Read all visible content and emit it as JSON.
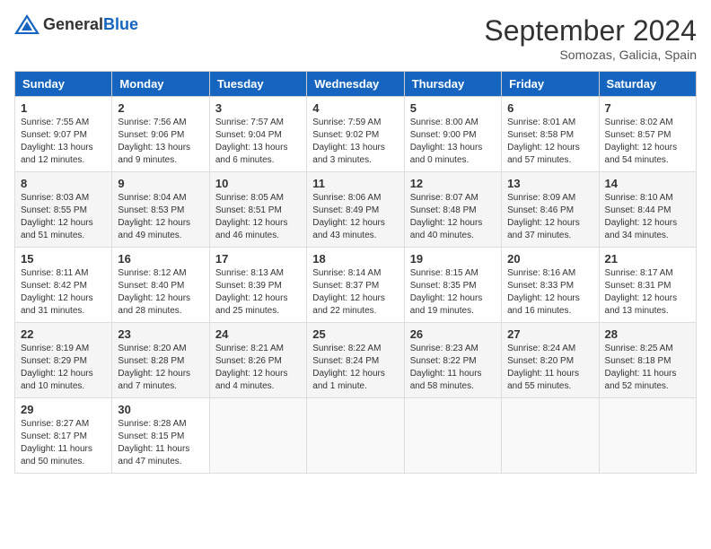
{
  "header": {
    "logo_general": "General",
    "logo_blue": "Blue",
    "month": "September 2024",
    "location": "Somozas, Galicia, Spain"
  },
  "weekdays": [
    "Sunday",
    "Monday",
    "Tuesday",
    "Wednesday",
    "Thursday",
    "Friday",
    "Saturday"
  ],
  "weeks": [
    [
      {
        "day": "1",
        "sunrise": "7:55 AM",
        "sunset": "9:07 PM",
        "daylight": "13 hours and 12 minutes."
      },
      {
        "day": "2",
        "sunrise": "7:56 AM",
        "sunset": "9:06 PM",
        "daylight": "13 hours and 9 minutes."
      },
      {
        "day": "3",
        "sunrise": "7:57 AM",
        "sunset": "9:04 PM",
        "daylight": "13 hours and 6 minutes."
      },
      {
        "day": "4",
        "sunrise": "7:59 AM",
        "sunset": "9:02 PM",
        "daylight": "13 hours and 3 minutes."
      },
      {
        "day": "5",
        "sunrise": "8:00 AM",
        "sunset": "9:00 PM",
        "daylight": "13 hours and 0 minutes."
      },
      {
        "day": "6",
        "sunrise": "8:01 AM",
        "sunset": "8:58 PM",
        "daylight": "12 hours and 57 minutes."
      },
      {
        "day": "7",
        "sunrise": "8:02 AM",
        "sunset": "8:57 PM",
        "daylight": "12 hours and 54 minutes."
      }
    ],
    [
      {
        "day": "8",
        "sunrise": "8:03 AM",
        "sunset": "8:55 PM",
        "daylight": "12 hours and 51 minutes."
      },
      {
        "day": "9",
        "sunrise": "8:04 AM",
        "sunset": "8:53 PM",
        "daylight": "12 hours and 49 minutes."
      },
      {
        "day": "10",
        "sunrise": "8:05 AM",
        "sunset": "8:51 PM",
        "daylight": "12 hours and 46 minutes."
      },
      {
        "day": "11",
        "sunrise": "8:06 AM",
        "sunset": "8:49 PM",
        "daylight": "12 hours and 43 minutes."
      },
      {
        "day": "12",
        "sunrise": "8:07 AM",
        "sunset": "8:48 PM",
        "daylight": "12 hours and 40 minutes."
      },
      {
        "day": "13",
        "sunrise": "8:09 AM",
        "sunset": "8:46 PM",
        "daylight": "12 hours and 37 minutes."
      },
      {
        "day": "14",
        "sunrise": "8:10 AM",
        "sunset": "8:44 PM",
        "daylight": "12 hours and 34 minutes."
      }
    ],
    [
      {
        "day": "15",
        "sunrise": "8:11 AM",
        "sunset": "8:42 PM",
        "daylight": "12 hours and 31 minutes."
      },
      {
        "day": "16",
        "sunrise": "8:12 AM",
        "sunset": "8:40 PM",
        "daylight": "12 hours and 28 minutes."
      },
      {
        "day": "17",
        "sunrise": "8:13 AM",
        "sunset": "8:39 PM",
        "daylight": "12 hours and 25 minutes."
      },
      {
        "day": "18",
        "sunrise": "8:14 AM",
        "sunset": "8:37 PM",
        "daylight": "12 hours and 22 minutes."
      },
      {
        "day": "19",
        "sunrise": "8:15 AM",
        "sunset": "8:35 PM",
        "daylight": "12 hours and 19 minutes."
      },
      {
        "day": "20",
        "sunrise": "8:16 AM",
        "sunset": "8:33 PM",
        "daylight": "12 hours and 16 minutes."
      },
      {
        "day": "21",
        "sunrise": "8:17 AM",
        "sunset": "8:31 PM",
        "daylight": "12 hours and 13 minutes."
      }
    ],
    [
      {
        "day": "22",
        "sunrise": "8:19 AM",
        "sunset": "8:29 PM",
        "daylight": "12 hours and 10 minutes."
      },
      {
        "day": "23",
        "sunrise": "8:20 AM",
        "sunset": "8:28 PM",
        "daylight": "12 hours and 7 minutes."
      },
      {
        "day": "24",
        "sunrise": "8:21 AM",
        "sunset": "8:26 PM",
        "daylight": "12 hours and 4 minutes."
      },
      {
        "day": "25",
        "sunrise": "8:22 AM",
        "sunset": "8:24 PM",
        "daylight": "12 hours and 1 minute."
      },
      {
        "day": "26",
        "sunrise": "8:23 AM",
        "sunset": "8:22 PM",
        "daylight": "11 hours and 58 minutes."
      },
      {
        "day": "27",
        "sunrise": "8:24 AM",
        "sunset": "8:20 PM",
        "daylight": "11 hours and 55 minutes."
      },
      {
        "day": "28",
        "sunrise": "8:25 AM",
        "sunset": "8:18 PM",
        "daylight": "11 hours and 52 minutes."
      }
    ],
    [
      {
        "day": "29",
        "sunrise": "8:27 AM",
        "sunset": "8:17 PM",
        "daylight": "11 hours and 50 minutes."
      },
      {
        "day": "30",
        "sunrise": "8:28 AM",
        "sunset": "8:15 PM",
        "daylight": "11 hours and 47 minutes."
      },
      null,
      null,
      null,
      null,
      null
    ]
  ]
}
